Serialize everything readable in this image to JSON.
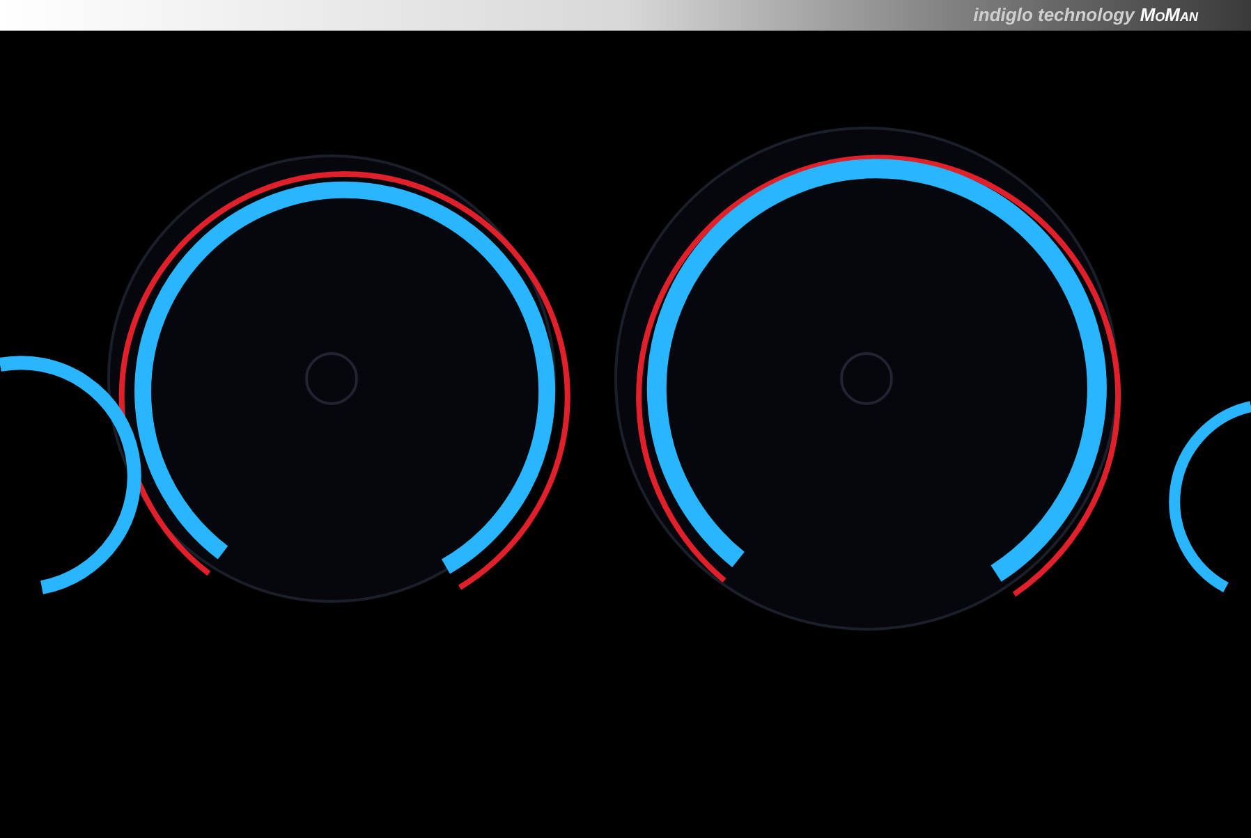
{
  "banner": {
    "tagline": "indiglo technology",
    "brand": "MoMan"
  }
}
